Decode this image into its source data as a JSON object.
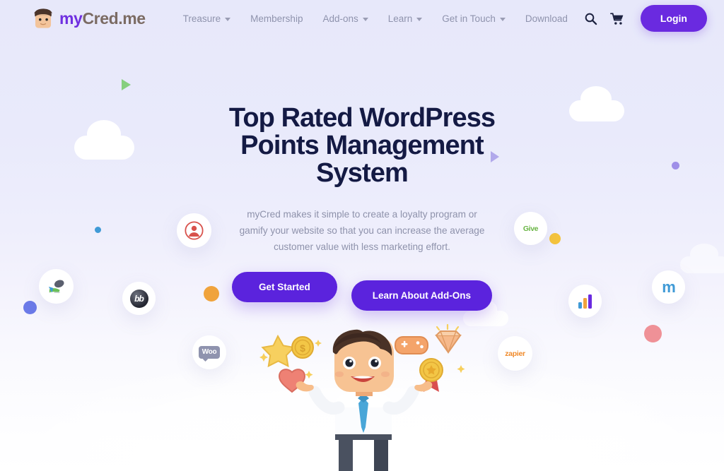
{
  "site": {
    "logo_my": "my",
    "logo_cred": "Cred.me",
    "logo_icon": "avatar-face-icon"
  },
  "header": {
    "nav": [
      {
        "label": "Treasure",
        "has_dropdown": true,
        "name": "nav-treasure"
      },
      {
        "label": "Membership",
        "has_dropdown": false,
        "name": "nav-membership"
      },
      {
        "label": "Add-ons",
        "has_dropdown": true,
        "name": "nav-addons"
      },
      {
        "label": "Learn",
        "has_dropdown": true,
        "name": "nav-learn"
      },
      {
        "label": "Get in Touch",
        "has_dropdown": true,
        "name": "nav-get-in-touch"
      },
      {
        "label": "Download",
        "has_dropdown": false,
        "name": "nav-download"
      }
    ],
    "search_icon": "search-icon",
    "cart_icon": "shopping-cart-icon",
    "login_label": "Login"
  },
  "hero": {
    "headline": "Top Rated WordPress Points Management System",
    "subtitle": "myCred makes it simple to create a loyalty program or gamify your website so that you can increase the average customer value with less marketing effort.",
    "primary_cta": "Get Started",
    "secondary_cta": "Learn About Add-Ons"
  },
  "integrations": [
    {
      "name": "buddypress-logo",
      "label": ""
    },
    {
      "name": "givewp-logo",
      "label": "Give"
    },
    {
      "name": "learndash-logo",
      "label": ""
    },
    {
      "name": "buddyboss-logo",
      "label": "bb"
    },
    {
      "name": "woocommerce-logo",
      "label": "Woo"
    },
    {
      "name": "zapier-logo",
      "label": "zapier"
    },
    {
      "name": "analytics-logo",
      "label": ""
    },
    {
      "name": "moodle-logo",
      "label": "m"
    }
  ],
  "colors": {
    "brand_purple": "#6a2ae0",
    "cta_purple": "#5b23dd",
    "headline_navy": "#141a44",
    "body_gray": "#8e92ab",
    "page_bg": "#e8e9fb",
    "dot_orange": "#f0a33c",
    "dot_yellow": "#f5c43c",
    "dot_blue": "#6b7ae8",
    "dot_pink": "#ef9197",
    "dot_purple": "#9f8fe8",
    "dot_teal": "#3f9ad6",
    "triangle_green": "#86cf7e",
    "triangle_purple": "#a79ce8"
  }
}
